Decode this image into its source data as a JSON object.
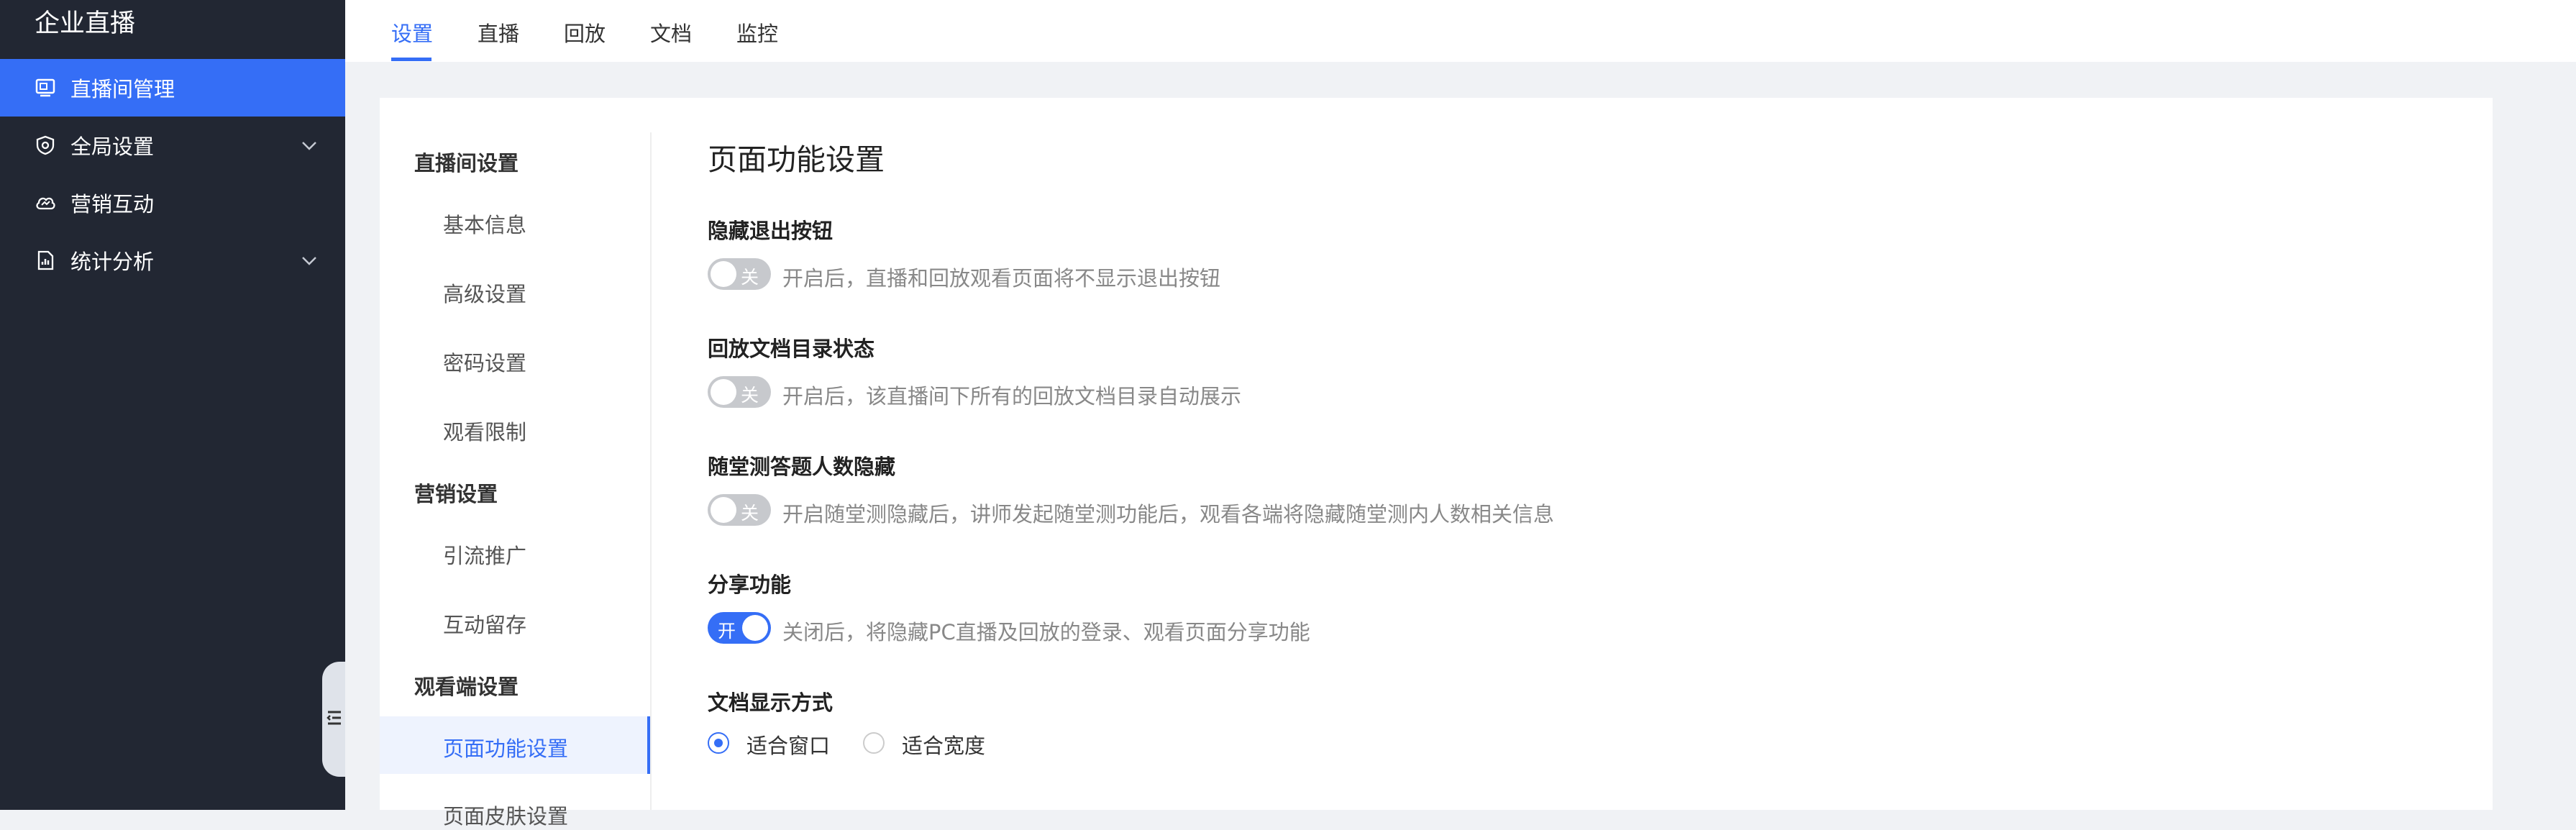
{
  "app": {
    "title": "企业直播"
  },
  "sidebar": {
    "items": [
      {
        "label": "直播间管理",
        "icon": "monitor-icon",
        "active": true
      },
      {
        "label": "全局设置",
        "icon": "shield-icon",
        "expandable": true
      },
      {
        "label": "营销互动",
        "icon": "cloud-icon"
      },
      {
        "label": "统计分析",
        "icon": "document-chart-icon",
        "expandable": true
      }
    ]
  },
  "tabs": [
    {
      "label": "设置",
      "active": true
    },
    {
      "label": "直播"
    },
    {
      "label": "回放"
    },
    {
      "label": "文档"
    },
    {
      "label": "监控"
    }
  ],
  "subnav": {
    "sections": [
      {
        "title": "直播间设置",
        "items": [
          "基本信息",
          "高级设置",
          "密码设置",
          "观看限制"
        ]
      },
      {
        "title": "营销设置",
        "items": [
          "引流推广",
          "互动留存"
        ]
      },
      {
        "title": "观看端设置",
        "items": [
          "页面功能设置",
          "页面皮肤设置"
        ]
      }
    ],
    "active_item": "页面功能设置"
  },
  "panel": {
    "title": "页面功能设置",
    "settings": [
      {
        "label": "隐藏退出按钮",
        "toggle": "off",
        "toggle_text": "关",
        "description": "开启后，直播和回放观看页面将不显示退出按钮"
      },
      {
        "label": "回放文档目录状态",
        "toggle": "off",
        "toggle_text": "关",
        "description": "开启后，该直播间下所有的回放文档目录自动展示"
      },
      {
        "label": "随堂测答题人数隐藏",
        "toggle": "off",
        "toggle_text": "关",
        "description": "开启随堂测隐藏后，讲师发起随堂测功能后，观看各端将隐藏随堂测内人数相关信息"
      },
      {
        "label": "分享功能",
        "toggle": "on",
        "toggle_text": "开",
        "description": "关闭后，将隐藏PC直播及回放的登录、观看页面分享功能"
      }
    ],
    "doc_display": {
      "label": "文档显示方式",
      "options": [
        "适合窗口",
        "适合宽度"
      ],
      "selected": "适合窗口"
    }
  },
  "colors": {
    "accent": "#356ef6",
    "sidebar_bg": "#222733",
    "page_bg": "#f0f2f5"
  }
}
